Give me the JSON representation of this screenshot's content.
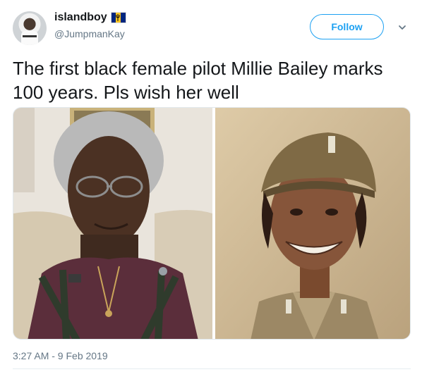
{
  "user": {
    "display_name": "islandboy",
    "handle": "@JumpmanKay",
    "flag_colors": [
      "#00267f",
      "#ffc726",
      "#00267f"
    ]
  },
  "actions": {
    "follow_label": "Follow"
  },
  "tweet": {
    "text": "The first black female pilot Millie Bailey marks 100 years. Pls wish her well",
    "timestamp": "3:27 AM - 9 Feb 2019"
  },
  "colors": {
    "accent": "#1da1f2",
    "muted": "#657786",
    "text": "#14171a"
  },
  "icons": {
    "menu": "chevron-down-icon"
  }
}
